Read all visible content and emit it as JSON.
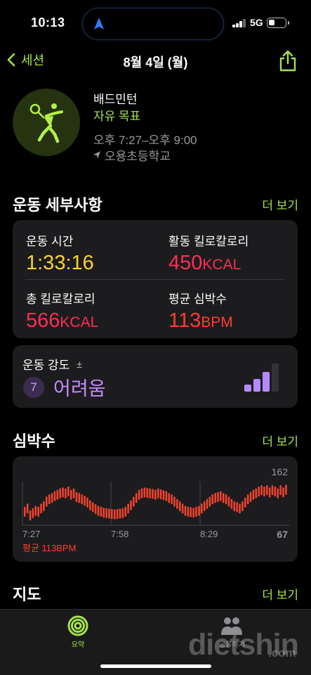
{
  "status": {
    "time": "10:13",
    "network": "5G"
  },
  "nav": {
    "back_label": "세션",
    "title": "8월 4일 (월)"
  },
  "activity": {
    "name": "배드민턴",
    "goal": "자유 목표",
    "time_range": "오후 7:27–오후 9:00",
    "location": "오용초등학교"
  },
  "details": {
    "title": "운동 세부사항",
    "more": "더 보기",
    "metrics": [
      {
        "label": "운동 시간",
        "value": "1:33:16",
        "unit": "",
        "color": "#fcd130"
      },
      {
        "label": "활동 킬로칼로리",
        "value": "450",
        "unit": "KCAL",
        "color": "#ff2d55"
      },
      {
        "label": "총 킬로칼로리",
        "value": "566",
        "unit": "KCAL",
        "color": "#ff2d55"
      },
      {
        "label": "평균 심박수",
        "value": "113",
        "unit": "BPM",
        "color": "#ff3b30"
      }
    ]
  },
  "intensity": {
    "label": "운동 강도",
    "adjust_symbol": "±",
    "level": "7",
    "text": "어려움",
    "filled_bars": 3,
    "total_bars": 4
  },
  "heart_rate": {
    "title": "심박수",
    "more": "더 보기",
    "max_label": "162",
    "min_label": "67",
    "avg_label": "평균 113BPM",
    "x_ticks": [
      "7:27",
      "7:58",
      "8:29"
    ]
  },
  "map": {
    "title": "지도",
    "more": "더 보기"
  },
  "tabbar": {
    "tabs": [
      {
        "label": "요약",
        "icon": "activity-rings-icon"
      },
      {
        "label": "공유하기",
        "icon": "sharing-people-icon"
      }
    ]
  },
  "watermark": {
    "text": "dietshin",
    "domain": ".com"
  },
  "colors": {
    "accent": "#a4e34a",
    "exercise_yellow": "#fcd130",
    "calorie_red": "#ff2d55",
    "heart_red": "#ff3b30",
    "intensity_purple": "#c58bff"
  },
  "chart_data": {
    "type": "bar",
    "title": "심박수",
    "x": [
      "7:27",
      "7:58",
      "8:29"
    ],
    "ylim": [
      67,
      162
    ],
    "values": [
      98,
      105,
      90,
      95,
      100,
      98,
      105,
      110,
      120,
      125,
      128,
      132,
      135,
      138,
      140,
      138,
      142,
      135,
      138,
      130,
      128,
      125,
      122,
      118,
      112,
      108,
      104,
      100,
      98,
      96,
      95,
      94,
      93,
      92,
      93,
      94,
      95,
      98,
      105,
      112,
      120,
      128,
      135,
      138,
      140,
      139,
      138,
      137,
      135,
      138,
      136,
      134,
      132,
      128,
      125,
      120,
      115,
      110,
      105,
      100,
      98,
      97,
      96,
      98,
      100,
      105,
      110,
      115,
      120,
      125,
      128,
      130,
      132,
      128,
      125,
      120,
      115,
      110,
      108,
      105,
      110,
      118,
      125,
      130,
      135,
      138,
      142,
      145,
      142,
      145,
      140,
      145,
      142,
      138,
      145,
      140,
      146
    ]
  }
}
